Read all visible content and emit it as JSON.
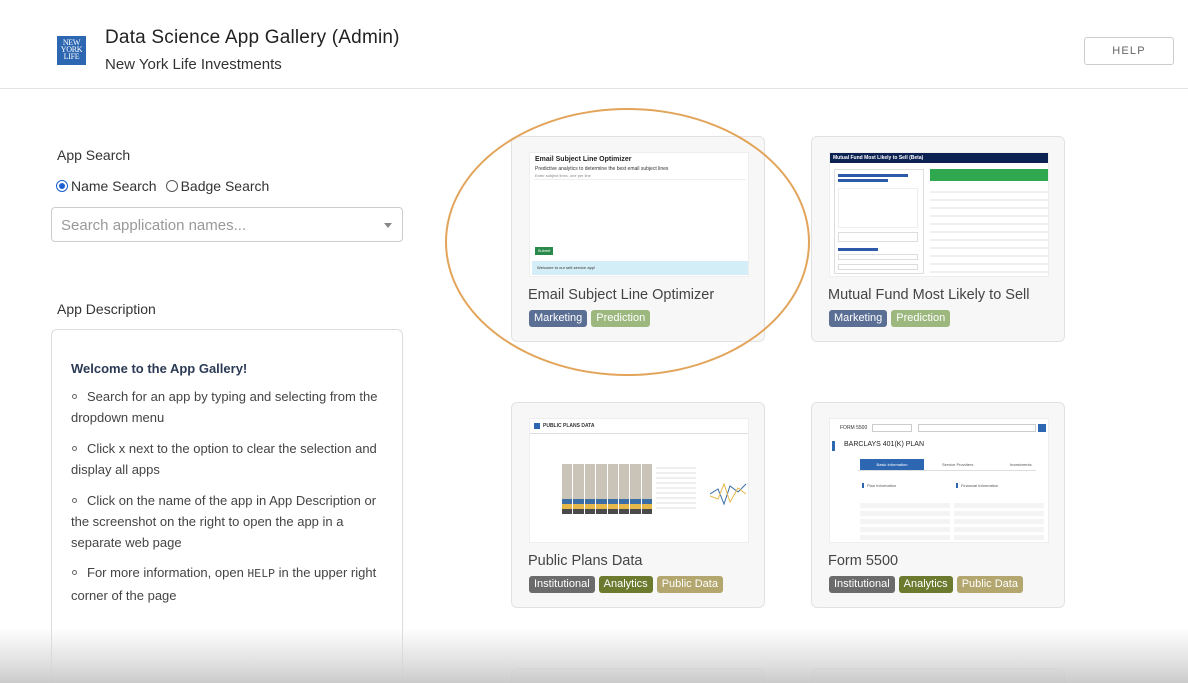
{
  "header": {
    "title": "Data Science App Gallery (Admin)",
    "subtitle": "New York Life Investments",
    "logo_text": "NEW YORK LIFE",
    "help_label": "HELP"
  },
  "search": {
    "heading": "App Search",
    "options": [
      "Name Search",
      "Badge Search"
    ],
    "selected": "Name Search",
    "placeholder": "Search application names..."
  },
  "description": {
    "heading": "App Description",
    "title": "Welcome to the App Gallery!",
    "items": [
      "Search for an app by typing and selecting from the dropdown menu",
      "Click x next to the option to clear the selection and display all apps",
      "Click on the name of the app in App Description or the screenshot on the right to open the app in a separate web page"
    ],
    "help_item": {
      "before": "For more information, open ",
      "code": "HELP",
      "after": " in the upper right corner of the page"
    }
  },
  "badge_colors": {
    "Marketing": "#5b6f95",
    "Prediction": "#9cb87f",
    "Institutional": "#6b6b6b",
    "Analytics": "#6b7a2f",
    "Public Data": "#b3a66e"
  },
  "apps": [
    {
      "title": "Email Subject Line Optimizer",
      "badges": [
        "Marketing",
        "Prediction"
      ],
      "thumb": {
        "heading": "Email Subject Line Optimizer",
        "subheading": "Predictive analytics to determine the best email subject lines",
        "hint": "Enter subject lines, one per line",
        "button": "Submit",
        "notice": "Welcome to our self-service app!"
      }
    },
    {
      "title": "Mutual Fund Most Likely to Sell",
      "badges": [
        "Marketing",
        "Prediction"
      ],
      "thumb": {
        "heading": "Mutual Fund Most Likely to Sell (Beta)"
      }
    },
    {
      "title": "Public Plans Data",
      "badges": [
        "Institutional",
        "Analytics",
        "Public Data"
      ],
      "thumb": {
        "heading": "PUBLIC PLANS DATA"
      }
    },
    {
      "title": "Form 5500",
      "badges": [
        "Institutional",
        "Analytics",
        "Public Data"
      ],
      "thumb": {
        "heading": "FORM 5500",
        "plan": "BARCLAYS 401(K) PLAN",
        "tabs": [
          "Basic Information",
          "Service Providers",
          "Investments"
        ],
        "section_left": "Plan Information",
        "section_right": "Financial Information"
      }
    }
  ]
}
